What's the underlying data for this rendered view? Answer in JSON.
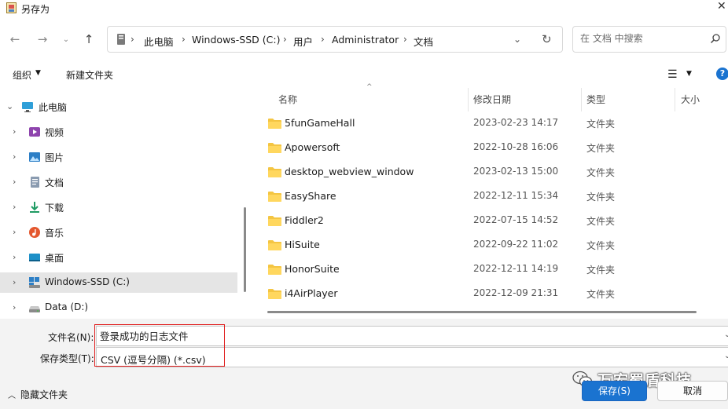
{
  "window": {
    "title": "另存为"
  },
  "nav": {
    "breadcrumbs": [
      "此电脑",
      "Windows-SSD (C:)",
      "用户",
      "Administrator",
      "文档"
    ],
    "search_placeholder": "在 文档 中搜索"
  },
  "toolbar": {
    "organize": "组织",
    "new_folder": "新建文件夹"
  },
  "sidebar": {
    "items": [
      {
        "label": "此电脑",
        "icon": "computer-icon"
      },
      {
        "label": "视频",
        "icon": "video-icon"
      },
      {
        "label": "图片",
        "icon": "pictures-icon"
      },
      {
        "label": "文档",
        "icon": "documents-icon"
      },
      {
        "label": "下载",
        "icon": "download-icon"
      },
      {
        "label": "音乐",
        "icon": "music-icon"
      },
      {
        "label": "桌面",
        "icon": "desktop-icon"
      },
      {
        "label": "Windows-SSD (C:)",
        "icon": "drive-icon",
        "selected": true
      },
      {
        "label": "Data (D:)",
        "icon": "drive-icon"
      }
    ]
  },
  "table": {
    "headers": {
      "name": "名称",
      "date": "修改日期",
      "type": "类型",
      "size": "大小"
    },
    "rows": [
      {
        "name": "5funGameHall",
        "date": "2023-02-23 14:17",
        "type": "文件夹"
      },
      {
        "name": "Apowersoft",
        "date": "2022-10-28 16:06",
        "type": "文件夹"
      },
      {
        "name": "desktop_webview_window",
        "date": "2023-02-13 15:00",
        "type": "文件夹"
      },
      {
        "name": "EasyShare",
        "date": "2022-12-11 15:34",
        "type": "文件夹"
      },
      {
        "name": "Fiddler2",
        "date": "2022-07-15 14:52",
        "type": "文件夹"
      },
      {
        "name": "HiSuite",
        "date": "2022-09-22 11:02",
        "type": "文件夹"
      },
      {
        "name": "HonorSuite",
        "date": "2022-12-11 14:19",
        "type": "文件夹"
      },
      {
        "name": "i4AirPlayer",
        "date": "2022-12-09 21:31",
        "type": "文件夹"
      }
    ]
  },
  "form": {
    "filename_label": "文件名(N):",
    "filename_value": "登录成功的日志文件",
    "filetype_label": "保存类型(T):",
    "filetype_value": "CSV (逗号分隔) (*.csv)"
  },
  "footer": {
    "hide_folders": "隐藏文件夹",
    "save": "保存(S)",
    "cancel": "取消",
    "watermark": "万宏蜀盾科技"
  },
  "colors": {
    "accent": "#1a73d0",
    "highlight_box": "#e01e1e",
    "folder": "#f4c542"
  }
}
